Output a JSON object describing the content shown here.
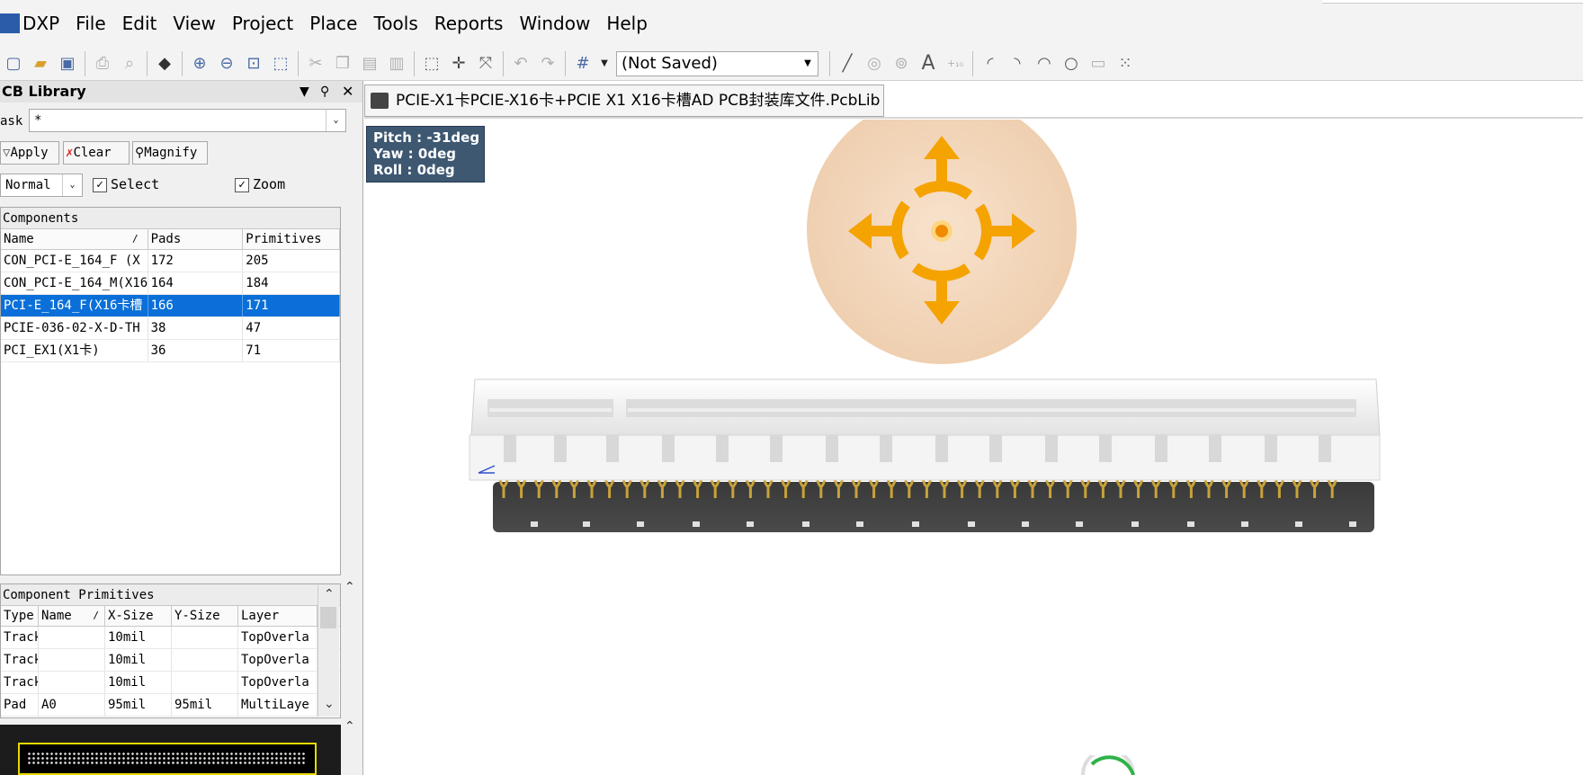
{
  "menu": {
    "items": [
      "DXP",
      "File",
      "Edit",
      "View",
      "Project",
      "Place",
      "Tools",
      "Reports",
      "Window",
      "Help"
    ]
  },
  "toolbar": {
    "zoom_combo_value": "(Not Saved)"
  },
  "panel": {
    "title": "CB Library",
    "mask_label": "ask",
    "mask_value": "*",
    "apply_label": "Apply",
    "clear_label": "Clear",
    "magnify_label": "Magnify",
    "mode_value": "Normal",
    "select_label": "Select",
    "zoom_label": "Zoom",
    "select_checked": true,
    "zoom_checked": true
  },
  "components": {
    "caption": "Components",
    "columns": [
      "Name",
      "Pads",
      "Primitives"
    ],
    "rows": [
      {
        "name": "CON_PCI-E_164_F (X",
        "pads": "172",
        "primitives": "205"
      },
      {
        "name": "CON_PCI-E_164_M(X16",
        "pads": "164",
        "primitives": "184"
      },
      {
        "name": "PCI-E_164_F(X16卡槽",
        "pads": "166",
        "primitives": "171"
      },
      {
        "name": "PCIE-036-02-X-D-TH",
        "pads": "38",
        "primitives": "47"
      },
      {
        "name": "PCI_EX1(X1卡)",
        "pads": "36",
        "primitives": "71"
      }
    ],
    "selected_index": 2
  },
  "primitives": {
    "caption": "Component Primitives",
    "columns": [
      "Type",
      "Name",
      "X-Size",
      "Y-Size",
      "Layer"
    ],
    "rows": [
      {
        "type": "Track",
        "name": "",
        "xsize": "10mil",
        "ysize": "",
        "layer": "TopOverla"
      },
      {
        "type": "Track",
        "name": "",
        "xsize": "10mil",
        "ysize": "",
        "layer": "TopOverla"
      },
      {
        "type": "Track",
        "name": "",
        "xsize": "10mil",
        "ysize": "",
        "layer": "TopOverla"
      },
      {
        "type": "Pad",
        "name": "A0",
        "xsize": "95mil",
        "ysize": "95mil",
        "layer": "MultiLaye"
      }
    ]
  },
  "document": {
    "tab_label": "PCIE-X1卡PCIE-X16卡+PCIE X1 X16卡槽AD PCB封装库文件.PcbLib",
    "pitch": "Pitch : -31deg",
    "yaw": "Yaw : 0deg",
    "roll": "Roll : 0deg"
  },
  "colors": {
    "selection": "#0a6fd8",
    "nav_orange": "#f5a300",
    "nav_disc": "#f3d8bc",
    "overlay_bg": "#3e5872",
    "pcb_dark": "#333333",
    "pin_gold": "#c8a23a"
  },
  "icons": {
    "app_logo": "dxp-icon",
    "navigator": "3d-pan-navigator-icon"
  }
}
